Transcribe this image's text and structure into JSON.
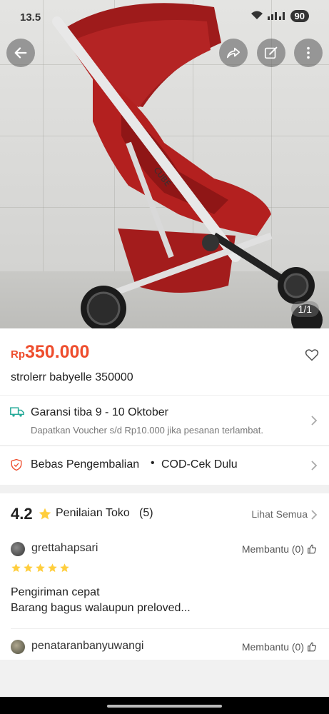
{
  "status_bar": {
    "time": "13.5",
    "battery": "90"
  },
  "gallery": {
    "pager": "1/1",
    "product_brand_text": "CUBE"
  },
  "product": {
    "currency": "Rp",
    "price": "350.000",
    "title": "strolerr babyelle 350000"
  },
  "shipping": {
    "main": "Garansi tiba 9 - 10 Oktober",
    "sub": "Dapatkan Voucher s/d Rp10.000 jika pesanan terlambat."
  },
  "returns": {
    "free_return": "Bebas Pengembalian",
    "separator": "•",
    "cod": "COD-Cek Dulu"
  },
  "ratings": {
    "score": "4.2",
    "label": "Penilaian Toko",
    "count": "(5)",
    "see_all": "Lihat Semua",
    "reviews": [
      {
        "user": "grettahapsari",
        "helpful": "Membantu (0)",
        "stars": 5,
        "text_line1": "Pengiriman cepat",
        "text_line2": "Barang bagus walaupun preloved..."
      },
      {
        "user": "penataranbanyuwangi",
        "helpful": "Membantu (0)"
      }
    ]
  },
  "colors": {
    "accent": "#ee4d2d",
    "teal": "#26aa99",
    "star": "#ffce3d"
  }
}
